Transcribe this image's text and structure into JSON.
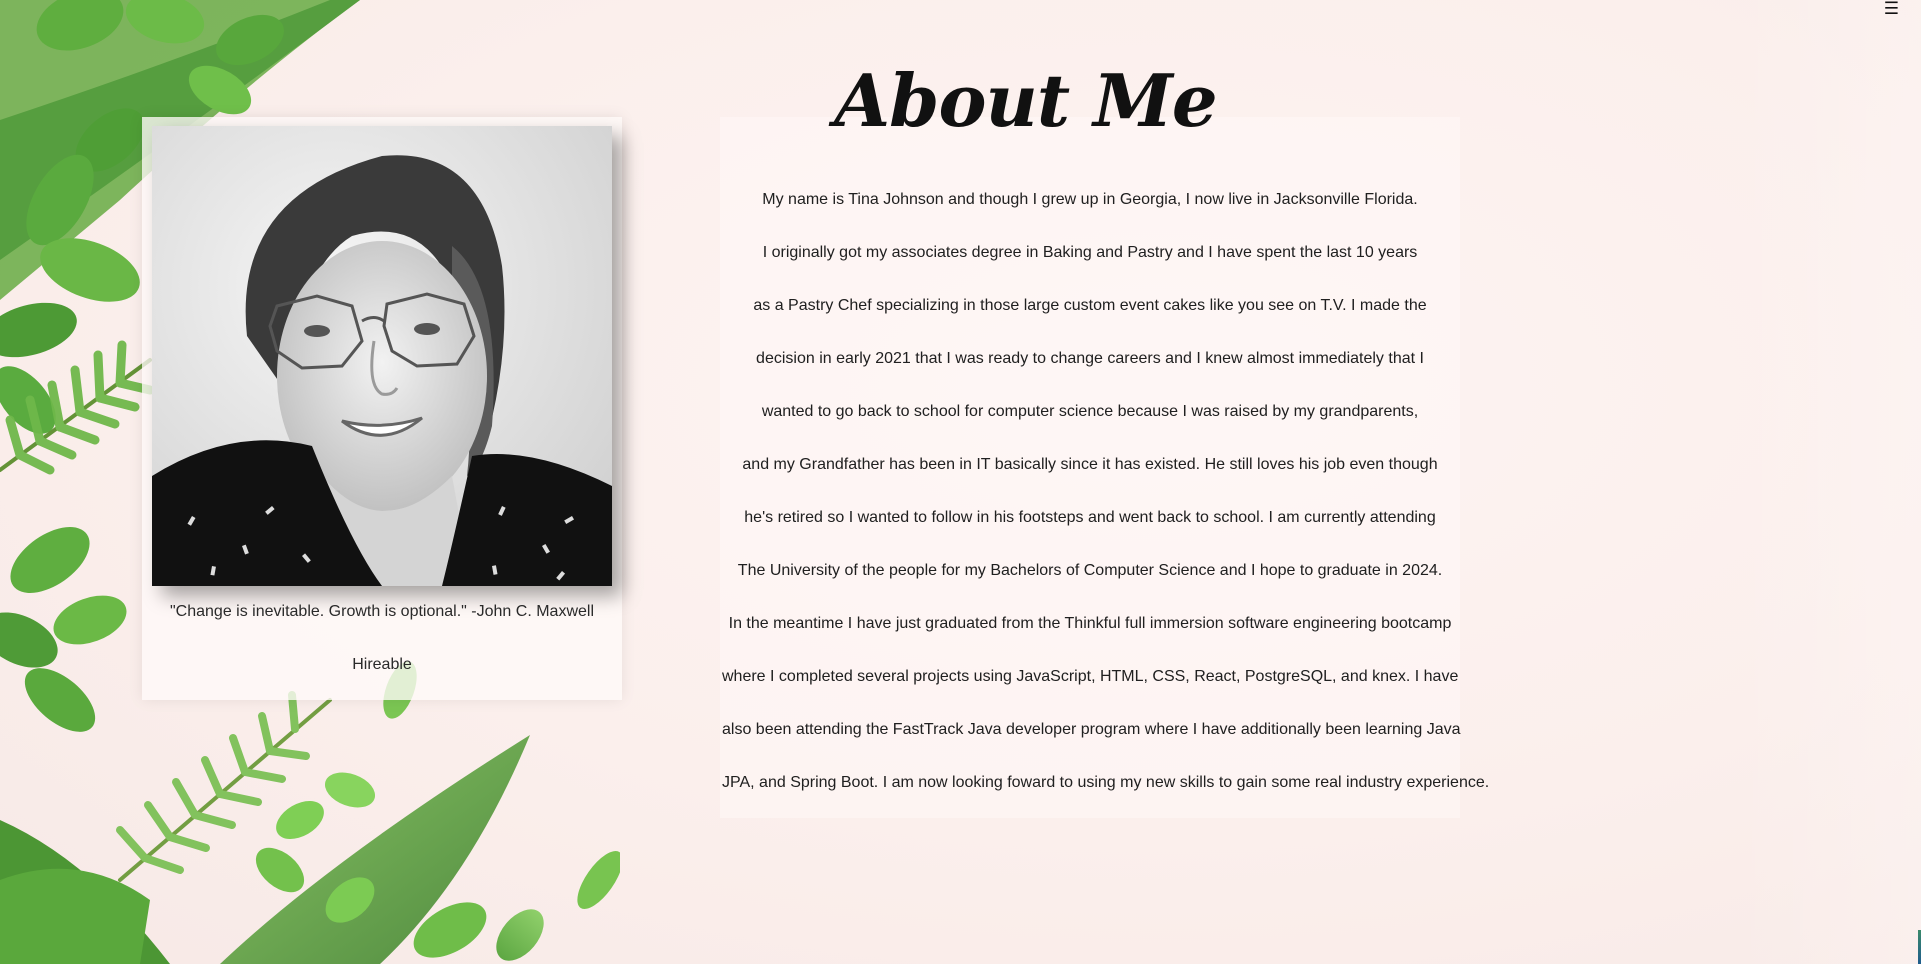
{
  "page": {
    "menu_icon": "hamburger-menu-icon",
    "menu_glyph": "☰"
  },
  "about": {
    "title": "About Me",
    "lines": [
      "My name is Tina Johnson and though I grew up in Georgia, I now live in Jacksonville Florida.",
      "I originally got my associates degree in Baking and Pastry and I have spent the last 10 years",
      "as a Pastry Chef specializing in those large custom event cakes like you see on T.V. I made the",
      "decision in early 2021 that I was ready to change careers and I knew almost immediately that I",
      "wanted to go back to school for computer science because I was raised by my grandparents,",
      "and my Grandfather has been in IT basically since it has existed. He still loves his job even though",
      "he's retired so I wanted to follow in his footsteps and went back to school. I am currently attending",
      "The University of the people for my Bachelors of Computer Science and I hope to graduate in 2024.",
      "In the meantime I have just graduated from the Thinkful full immersion software engineering bootcamp",
      "where I completed several projects using JavaScript, HTML, CSS, React, PostgreSQL, and knex. I have",
      "also been attending the FastTrack Java developer program where I have additionally been learning Java",
      "JPA, and Spring Boot. I am now looking foward to using my new skills to gain some real industry experience."
    ]
  },
  "profile": {
    "quote": "\"Change is inevitable. Growth is optional.\" -John C. Maxwell",
    "status": "Hireable"
  },
  "colors": {
    "background": "#fbefec",
    "leaf_green": "#4f9a3a"
  }
}
